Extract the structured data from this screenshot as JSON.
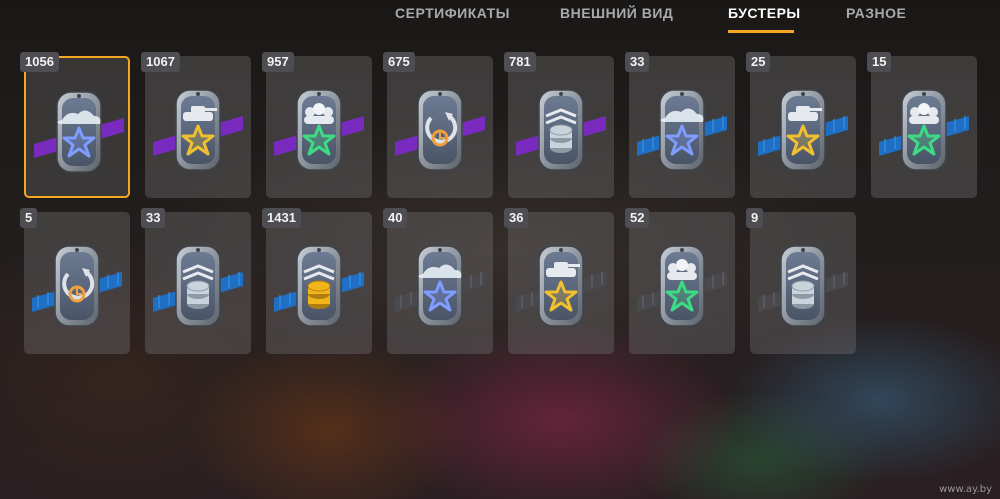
{
  "tabs": [
    {
      "label": "СЕРТИФИКАТЫ",
      "active": false
    },
    {
      "label": "ВНЕШНИЙ ВИД",
      "active": false
    },
    {
      "label": "БУСТЕРЫ",
      "active": true
    },
    {
      "label": "РАЗНОЕ",
      "active": false
    }
  ],
  "accent_color": "#f5a623",
  "boosters": [
    {
      "count": "1056",
      "icon": "cloud-star-icon",
      "star": "#7f9cff",
      "band": "purple",
      "selected": true
    },
    {
      "count": "1067",
      "icon": "tank-star-icon",
      "star": "#f0c030",
      "band": "purple"
    },
    {
      "count": "957",
      "icon": "crew-star-icon",
      "star": "#3ddc84",
      "band": "purple"
    },
    {
      "count": "675",
      "icon": "recharge-icon",
      "star": "#f0a040",
      "band": "purple"
    },
    {
      "count": "781",
      "icon": "silver-coins-icon",
      "star": "#c9d3dc",
      "band": "purple"
    },
    {
      "count": "33",
      "icon": "cloud-star-icon",
      "star": "#7f9cff",
      "band": "blue"
    },
    {
      "count": "25",
      "icon": "tank-star-icon",
      "star": "#f0c030",
      "band": "blue"
    },
    {
      "count": "15",
      "icon": "crew-star-icon",
      "star": "#3ddc84",
      "band": "blue"
    },
    {
      "count": "5",
      "icon": "recharge-icon",
      "star": "#f0a040",
      "band": "blue"
    },
    {
      "count": "33",
      "icon": "silver-coins-icon",
      "star": "#c9d3dc",
      "band": "blue"
    },
    {
      "count": "1431",
      "icon": "gold-coins-icon",
      "star": "#f0c030",
      "band": "blue"
    },
    {
      "count": "40",
      "icon": "cloud-star-icon",
      "star": "#7f9cff",
      "band": "gray"
    },
    {
      "count": "36",
      "icon": "tank-star-icon",
      "star": "#f0c030",
      "band": "gray"
    },
    {
      "count": "52",
      "icon": "crew-star-icon",
      "star": "#3ddc84",
      "band": "gray"
    },
    {
      "count": "9",
      "icon": "silver-coins-icon",
      "star": "#c9d3dc",
      "band": "gray"
    }
  ],
  "watermark": "www.ay.by"
}
